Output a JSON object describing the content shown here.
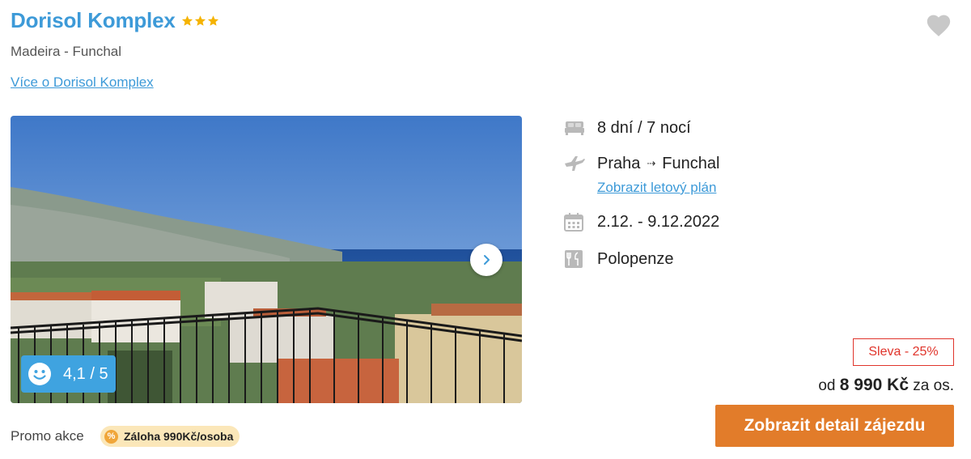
{
  "hotel": {
    "name": "Dorisol Komplex",
    "stars": 3,
    "location": "Madeira - Funchal",
    "more_link": "Více o Dorisol Komplex"
  },
  "photo": {
    "rating": "4,1 / 5"
  },
  "details": {
    "duration": "8 dní / 7 nocí",
    "from": "Praha",
    "arrow": "⇢",
    "to": "Funchal",
    "flight_link": "Zobrazit letový plán",
    "dates": "2.12. - 9.12.2022",
    "board": "Polopenze"
  },
  "pricing": {
    "discount": "Sleva - 25%",
    "prefix": "od",
    "price": "8 990 Kč",
    "suffix": "za os.",
    "button": "Zobrazit detail zájezdu"
  },
  "promo": {
    "label": "Promo akce",
    "badge": "Záloha 990Kč/osoba",
    "badge_icon": "%"
  },
  "colors": {
    "accent_blue": "#3d9ad8",
    "cta_orange": "#e27c2a",
    "discount_red": "#e0342b",
    "star_gold": "#f5b301"
  }
}
